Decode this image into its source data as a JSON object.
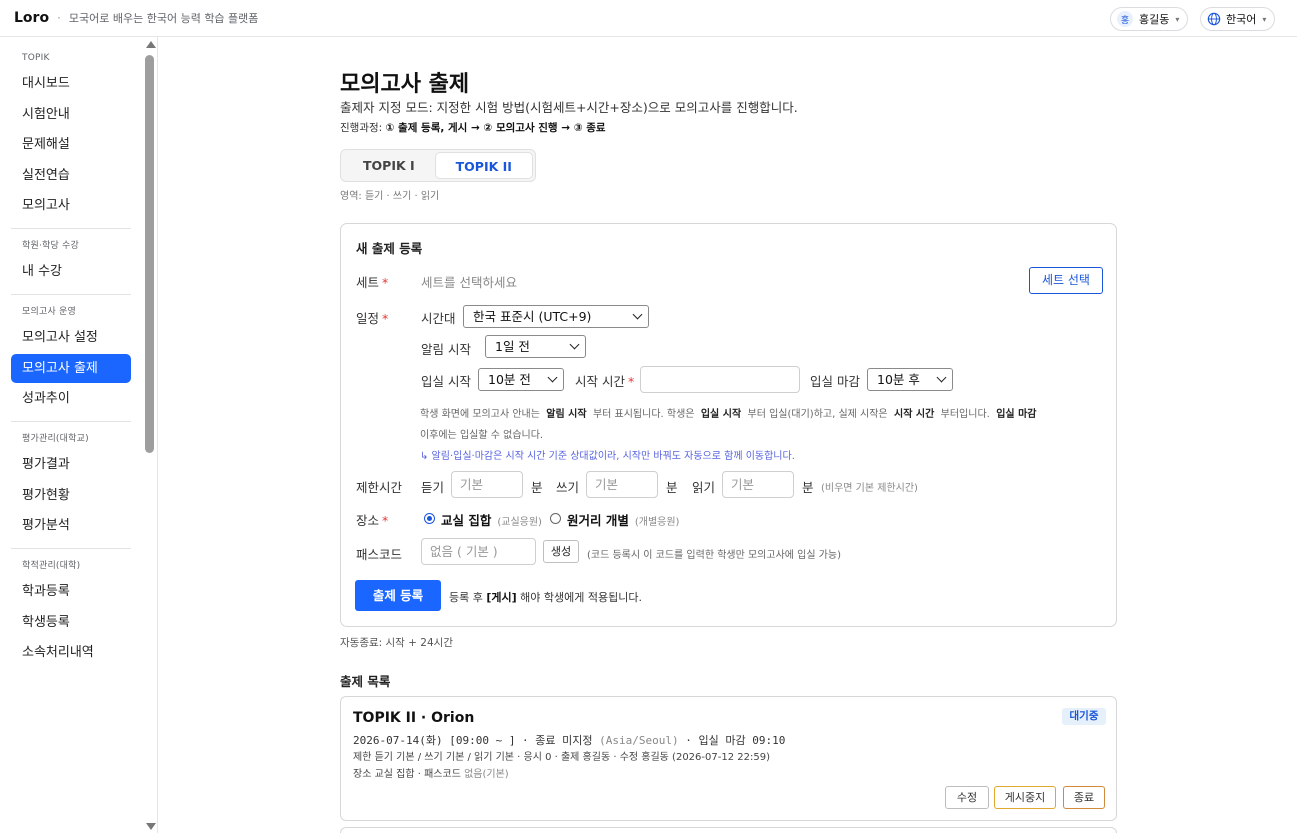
{
  "header": {
    "brand": "Loro",
    "separator": "·",
    "tagline": "모국어로 배우는 한국어 능력 학습 플랫폼",
    "user": {
      "initial": "홍",
      "name": "홍길동"
    },
    "language": "한국어"
  },
  "sidebar": {
    "sections": [
      {
        "title": "TOPIK",
        "items": [
          "대시보드",
          "시험안내",
          "문제해설",
          "실전연습",
          "모의고사"
        ]
      },
      {
        "title": "학원·학당 수강",
        "items": [
          "내 수강"
        ]
      },
      {
        "title": "모의고사 운영",
        "items": [
          "모의고사 설정",
          "모의고사 출제",
          "성과추이"
        ]
      },
      {
        "title": "평가관리(대학교)",
        "items": [
          "평가결과",
          "평가현황",
          "평가분석"
        ]
      },
      {
        "title": "학적관리(대학)",
        "items": [
          "학과등록",
          "학생등록",
          "소속처리내역"
        ]
      }
    ],
    "active": "모의고사 출제"
  },
  "page": {
    "title": "모의고사 출제",
    "description": "출제자 지정 모드: 지정한 시험 방법(시험세트+시간+장소)으로 모의고사를 진행합니다.",
    "progress_prefix": "진행과정: ",
    "progress_steps": "① 출제 등록, 게시 → ② 모의고사 진행 → ③ 종료",
    "tabs": [
      "TOPIK I",
      "TOPIK II"
    ],
    "active_tab": "TOPIK II",
    "area_note": "영역: 듣기 · 쓰기 · 읽기"
  },
  "form": {
    "title": "새 출제 등록",
    "set_label": "세트",
    "set_placeholder": "세트를 선택하세요",
    "set_button": "세트 선택",
    "schedule_label": "일정",
    "timezone_label": "시간대",
    "timezone_value": "한국 표준시 (UTC+9)",
    "alert_label": "알림 시작",
    "alert_value": "1일 전",
    "entry_label": "입실 시작",
    "entry_value": "10분 전",
    "start_label": "시작 시간",
    "start_value": "",
    "close_label": "입실 마감",
    "close_value": "10분 후",
    "hint1_parts": [
      "학생 화면에 모의고사 안내는",
      "알림 시작",
      "부터 표시됩니다. 학생은",
      "입실 시작",
      "부터 입실(대기)하고, 실제 시작은",
      "시작 시간",
      "부터입니다.",
      "입실 마감"
    ],
    "hint2": "이후에는 입실할 수 없습니다.",
    "hint3": "↳ 알림·입실·마감은 시작 시간 기준 상대값이라, 시작만 바꿔도 자동으로 함께 이동합니다.",
    "limit_label": "제한시간",
    "listen_label": "듣기",
    "write_label": "쓰기",
    "read_label": "읽기",
    "minute_unit": "분",
    "time_placeholder": "기본",
    "limit_note": "(비우면 기본 제한시간)",
    "place_label": "장소",
    "place_opt1": "교실 집합",
    "place_opt1_note": "(교실응원)",
    "place_opt2": "원거리 개별",
    "place_opt2_note": "(개별응원)",
    "passcode_label": "패스코드",
    "passcode_placeholder": "없음 ( 기본 )",
    "generate_button": "생성",
    "passcode_note": "(코드 등록시 이 코드를 입력한 학생만 모의고사에 입실 가능)",
    "submit_button": "출제 등록",
    "after_note_prefix": "등록 후 ",
    "after_note_bold": "[게시]",
    "after_note_suffix": " 해야 학생에게 적용됩니다."
  },
  "auto_end": "자동종료: 시작 + 24시간",
  "list": {
    "title": "출제 목록",
    "items": [
      {
        "title": "TOPIK II · Orion",
        "status": "대기중",
        "schedule_main": "2026-07-14(화) [09:00 ~ ] · 종료 미지정 ",
        "schedule_tz": "(Asia/Seoul)",
        "schedule_close": " · 입실 마감 09:10",
        "meta1": "제한 듣기 기본 / 쓰기 기본 / 읽기 기본 · 응시 0 · 출제 홍길동 · 수정 홍길동 (2026-07-12 22:59)",
        "meta2_main": "장소 교실 집합 · 패스코드 ",
        "meta2_grey": "없음(기본)",
        "actions": {
          "edit": "수정",
          "pause": "게시중지",
          "end": "종료"
        }
      }
    ]
  },
  "colors": {
    "accent": "#1a66ff",
    "link": "#1a56db",
    "required": "#e53935"
  }
}
